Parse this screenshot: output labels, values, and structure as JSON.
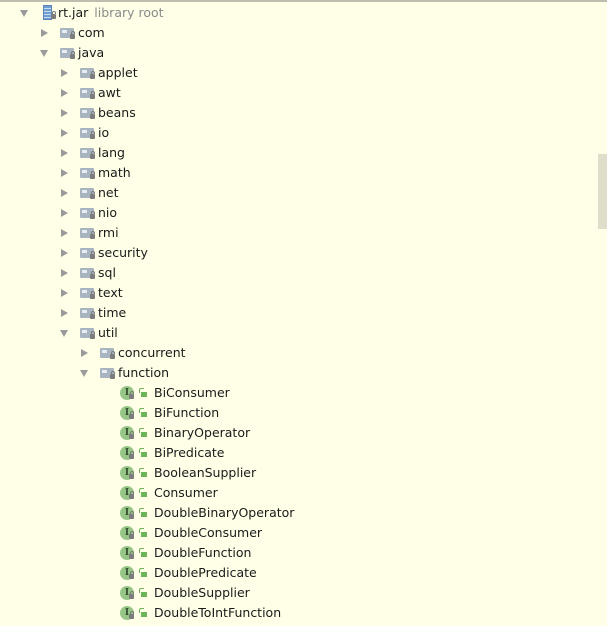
{
  "root": {
    "label": "rt.jar",
    "hint": "library root",
    "icon": "jar-icon"
  },
  "level1": [
    {
      "label": "com",
      "expanded": false
    },
    {
      "label": "java",
      "expanded": true
    }
  ],
  "java_children": [
    {
      "label": "applet",
      "expanded": false
    },
    {
      "label": "awt",
      "expanded": false
    },
    {
      "label": "beans",
      "expanded": false
    },
    {
      "label": "io",
      "expanded": false
    },
    {
      "label": "lang",
      "expanded": false
    },
    {
      "label": "math",
      "expanded": false
    },
    {
      "label": "net",
      "expanded": false
    },
    {
      "label": "nio",
      "expanded": false
    },
    {
      "label": "rmi",
      "expanded": false
    },
    {
      "label": "security",
      "expanded": false
    },
    {
      "label": "sql",
      "expanded": false
    },
    {
      "label": "text",
      "expanded": false
    },
    {
      "label": "time",
      "expanded": false
    },
    {
      "label": "util",
      "expanded": true
    }
  ],
  "util_children": [
    {
      "label": "concurrent",
      "expanded": false
    },
    {
      "label": "function",
      "expanded": true
    }
  ],
  "function_children": [
    {
      "label": "BiConsumer",
      "icon": "I"
    },
    {
      "label": "BiFunction",
      "icon": "I"
    },
    {
      "label": "BinaryOperator",
      "icon": "I"
    },
    {
      "label": "BiPredicate",
      "icon": "I"
    },
    {
      "label": "BooleanSupplier",
      "icon": "I"
    },
    {
      "label": "Consumer",
      "icon": "I"
    },
    {
      "label": "DoubleBinaryOperator",
      "icon": "I"
    },
    {
      "label": "DoubleConsumer",
      "icon": "I"
    },
    {
      "label": "DoubleFunction",
      "icon": "I"
    },
    {
      "label": "DoublePredicate",
      "icon": "I"
    },
    {
      "label": "DoubleSupplier",
      "icon": "I"
    },
    {
      "label": "DoubleToIntFunction",
      "icon": "I"
    }
  ],
  "colors": {
    "background": "#ffffe8",
    "interface_badge": "#96c587",
    "public_icon": "#6db35a",
    "package_icon": "#a8b4c0",
    "scrollbar": "#dedecb"
  }
}
